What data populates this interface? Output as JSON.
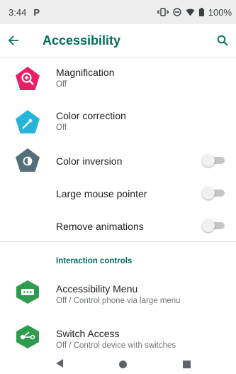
{
  "status_bar": {
    "time": "3:44",
    "notification_letter": "P",
    "battery": "100%"
  },
  "app_bar": {
    "title": "Accessibility"
  },
  "items": [
    {
      "title": "Magnification",
      "summary": "Off",
      "icon": "magnification-icon",
      "color": "#e91e63"
    },
    {
      "title": "Color correction",
      "summary": "Off",
      "icon": "color-correction-icon",
      "color": "#26b5d9"
    },
    {
      "title": "Color inversion",
      "icon": "color-inversion-icon",
      "color": "#546e7a",
      "toggle": false
    },
    {
      "title": "Large mouse pointer",
      "toggle": false
    },
    {
      "title": "Remove animations",
      "toggle": false
    }
  ],
  "section_header": "Interaction controls",
  "interaction_items": [
    {
      "title": "Accessibility Menu",
      "summary": "Off / Control phone via large menu",
      "icon": "accessibility-menu-icon",
      "color": "#2e9b4f"
    },
    {
      "title": "Switch Access",
      "summary": "Off / Control device with switches",
      "icon": "switch-access-icon",
      "color": "#2e9b4f"
    }
  ],
  "colors": {
    "accent": "#006d5b",
    "status_bar_bg": "#eeeeee"
  }
}
